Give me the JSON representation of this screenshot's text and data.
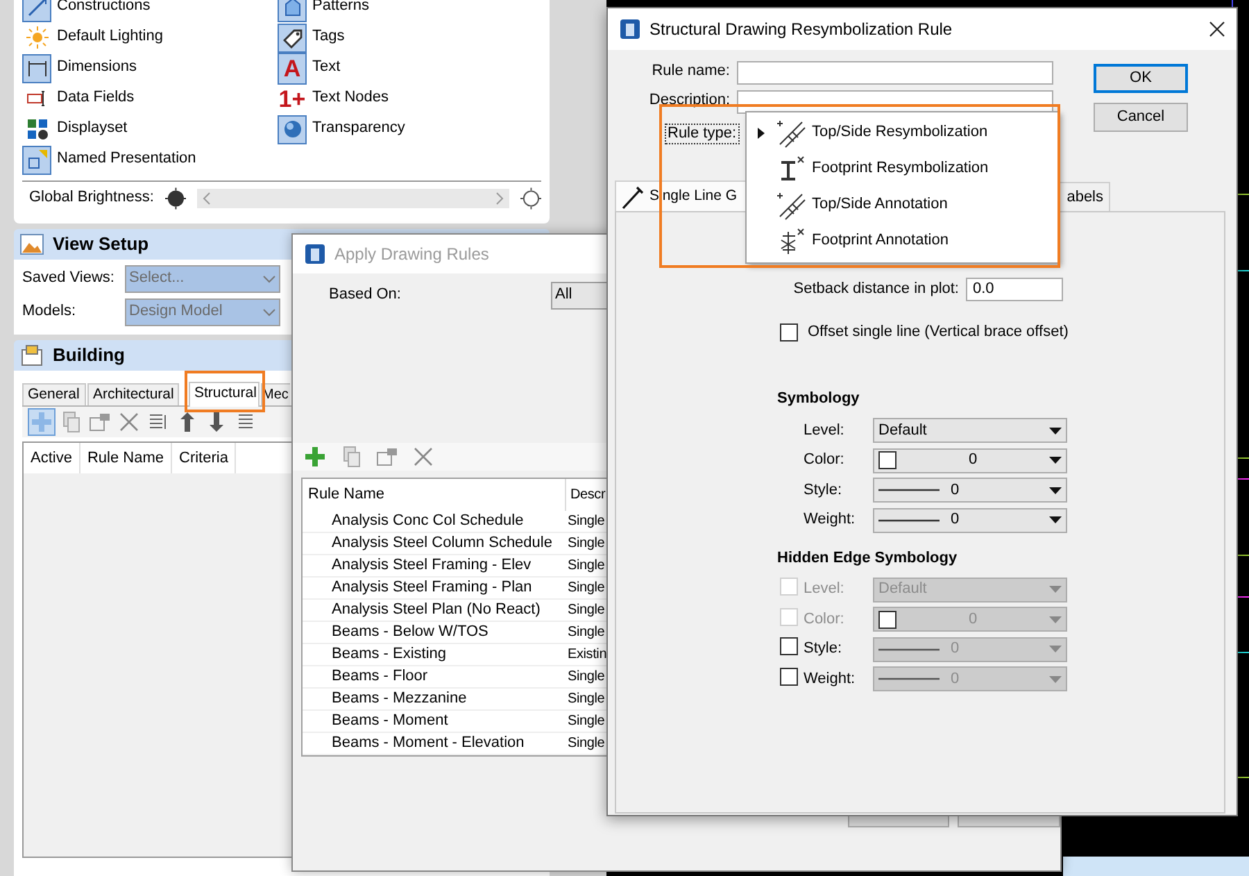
{
  "display_panel": {
    "items": [
      {
        "label": "Constructions",
        "on": true
      },
      {
        "label": "Patterns",
        "on": true
      },
      {
        "label": "Default Lighting",
        "on": false
      },
      {
        "label": "Tags",
        "on": true
      },
      {
        "label": "Dimensions",
        "on": true
      },
      {
        "label": "Text",
        "on": true,
        "icon_glyph": "A"
      },
      {
        "label": "Data Fields",
        "on": false
      },
      {
        "label": "Text Nodes",
        "on": false,
        "icon_glyph": "1+"
      },
      {
        "label": "Displayset",
        "on": false
      },
      {
        "label": "Transparency",
        "on": true
      },
      {
        "label": "Named Presentation",
        "on": true
      }
    ],
    "brightness_label": "Global Brightness:"
  },
  "view_setup": {
    "title": "View Setup",
    "fields": [
      {
        "label": "Saved Views:",
        "value": "Select...",
        "disabled": true
      },
      {
        "label": "Models:",
        "value": "Design Model",
        "disabled": true
      }
    ]
  },
  "building": {
    "title": "Building",
    "tabs": [
      {
        "label": "General",
        "selected": false
      },
      {
        "label": "Architectural",
        "selected": false
      },
      {
        "label": "Structural",
        "selected": true
      },
      {
        "label": "Mec",
        "selected": false
      }
    ],
    "columns": [
      "Active",
      "Rule Name",
      "Criteria"
    ]
  },
  "apply_window": {
    "title": "Apply Drawing Rules",
    "active": false,
    "based_on_label": "Based On:",
    "based_on_value": "All",
    "columns": [
      "Rule Name",
      "Descr"
    ],
    "rows": [
      {
        "name": "Analysis Conc Col Schedule",
        "description": "Single"
      },
      {
        "name": "Analysis Steel Column Schedule",
        "description": "Single"
      },
      {
        "name": "Analysis Steel Framing - Elev",
        "description": "Single"
      },
      {
        "name": "Analysis Steel Framing - Plan",
        "description": "Single"
      },
      {
        "name": "Analysis Steel Plan (No React)",
        "description": "Single"
      },
      {
        "name": "Beams - Below W/TOS",
        "description": "Single"
      },
      {
        "name": "Beams - Existing",
        "description": "Existin"
      },
      {
        "name": "Beams - Floor",
        "description": "Single"
      },
      {
        "name": "Beams - Mezzanine",
        "description": "Single"
      },
      {
        "name": "Beams - Moment",
        "description": "Single"
      },
      {
        "name": "Beams - Moment - Elevation",
        "description": "Single"
      }
    ]
  },
  "dialog": {
    "title": "Structural Drawing Resymbolization Rule",
    "active": true,
    "fields": [
      {
        "label": "Rule name:"
      },
      {
        "label": "Description:"
      }
    ],
    "rule_type_label": "Rule type:",
    "buttons": [
      {
        "label": "OK",
        "default": true
      },
      {
        "label": "Cancel",
        "default": false
      }
    ],
    "rule_type_menu": [
      {
        "label": "Top/Side Resymbolization",
        "selected": true
      },
      {
        "label": "Footprint Resymbolization",
        "selected": false
      },
      {
        "label": "Top/Side Annotation",
        "selected": false
      },
      {
        "label": "Footprint Annotation",
        "selected": false
      }
    ],
    "tabs": [
      {
        "label": "Single Line G",
        "selected": true
      },
      {
        "label": "abels",
        "selected": false
      }
    ],
    "setback": {
      "label": "Setback distance in plot:",
      "value": "0.0"
    },
    "offset": {
      "label": "Offset single line (Vertical brace offset)",
      "checked": false
    },
    "symbology": {
      "title": "Symbology",
      "rows": [
        {
          "label": "Level:",
          "kind": "text",
          "value": "Default"
        },
        {
          "label": "Color:",
          "kind": "color",
          "value": "0"
        },
        {
          "label": "Style:",
          "kind": "line",
          "value": "0"
        },
        {
          "label": "Weight:",
          "kind": "line",
          "value": "0"
        }
      ]
    },
    "hidden_edge": {
      "title": "Hidden Edge Symbology",
      "rows": [
        {
          "label": "Level:",
          "kind": "text",
          "value": "Default",
          "enabled": false,
          "checked": false
        },
        {
          "label": "Color:",
          "kind": "color",
          "value": "0",
          "enabled": false,
          "checked": false
        },
        {
          "label": "Style:",
          "kind": "line",
          "value": "0",
          "enabled": true,
          "checked": false
        },
        {
          "label": "Weight:",
          "kind": "line",
          "value": "0",
          "enabled": true,
          "checked": false
        }
      ]
    }
  }
}
